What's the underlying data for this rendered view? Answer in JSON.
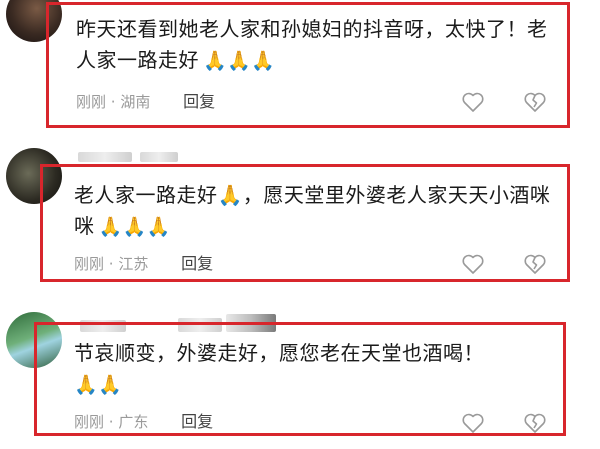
{
  "comments": [
    {
      "text": "昨天还看到她老人家和孙媳妇的抖音呀，太快了！老人家一路走好",
      "emoji": "🙏🙏🙏",
      "time": "刚刚",
      "sep": "·",
      "location": "湖南",
      "reply": "回复"
    },
    {
      "text": "老人家一路走好🙏，愿天堂里外婆老人家天天小酒咪咪",
      "emoji": "🙏🙏🙏",
      "time": "刚刚",
      "sep": "·",
      "location": "江苏",
      "reply": "回复"
    },
    {
      "text": "节哀顺变，外婆走好，愿您老在天堂也酒喝！",
      "emoji": "🙏🙏",
      "time": "刚刚",
      "sep": "·",
      "location": "广东",
      "reply": "回复"
    }
  ],
  "colors": {
    "highlight": "#d8262c",
    "meta": "#9a9a9a"
  },
  "icons": [
    "heart-outline-icon",
    "broken-heart-icon"
  ]
}
